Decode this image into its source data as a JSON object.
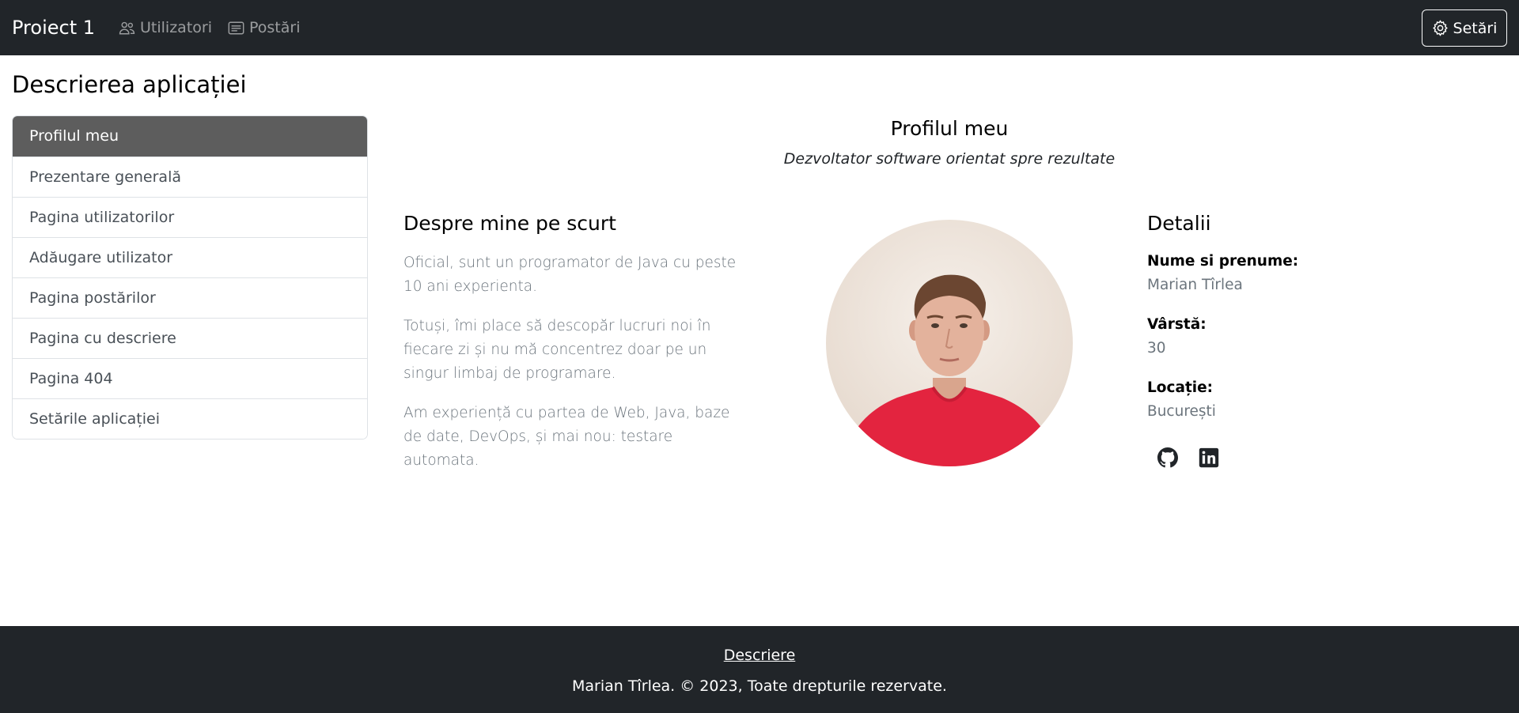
{
  "navbar": {
    "brand": "Proiect 1",
    "links": [
      {
        "label": "Utilizatori",
        "icon": "people-icon"
      },
      {
        "label": "Postări",
        "icon": "card-text-icon"
      }
    ],
    "settings_label": "Setări",
    "settings_icon": "gear-icon"
  },
  "page_title": "Descrierea aplicației",
  "sidebar": {
    "items": [
      {
        "label": "Profilul meu",
        "active": true
      },
      {
        "label": "Prezentare generală"
      },
      {
        "label": "Pagina utilizatorilor"
      },
      {
        "label": "Adăugare utilizator"
      },
      {
        "label": "Pagina postărilor"
      },
      {
        "label": "Pagina cu descriere"
      },
      {
        "label": "Pagina 404"
      },
      {
        "label": "Setările aplicației"
      }
    ]
  },
  "profile": {
    "title": "Profilul meu",
    "subtitle": "Dezvoltator software orientat spre rezultate"
  },
  "about": {
    "title": "Despre mine pe scurt",
    "paragraphs": [
      "Oficial, sunt un programator de Java cu peste 10 ani experienta.",
      "Totuși, îmi place să descopăr lucruri noi în fiecare zi și nu mă concentrez doar pe un singur limbaj de programare.",
      "Am experiență cu partea de Web, Java, baze de date, DevOps, și mai nou: testare automata."
    ]
  },
  "details": {
    "title": "Detalii",
    "name_label": "Nume si prenume:",
    "name_value": "Marian Tîrlea",
    "age_label": "Vârstă:",
    "age_value": "30",
    "location_label": "Locație:",
    "location_value": "București",
    "social": [
      {
        "icon": "github-icon"
      },
      {
        "icon": "linkedin-icon"
      }
    ]
  },
  "footer": {
    "link": "Descriere",
    "copyright": "Marian Tîrlea. © 2023, Toate drepturile rezervate."
  },
  "colors": {
    "navbar_bg": "#212529",
    "active_item_bg": "#5d5d5d",
    "shirt": "#e3243f"
  }
}
